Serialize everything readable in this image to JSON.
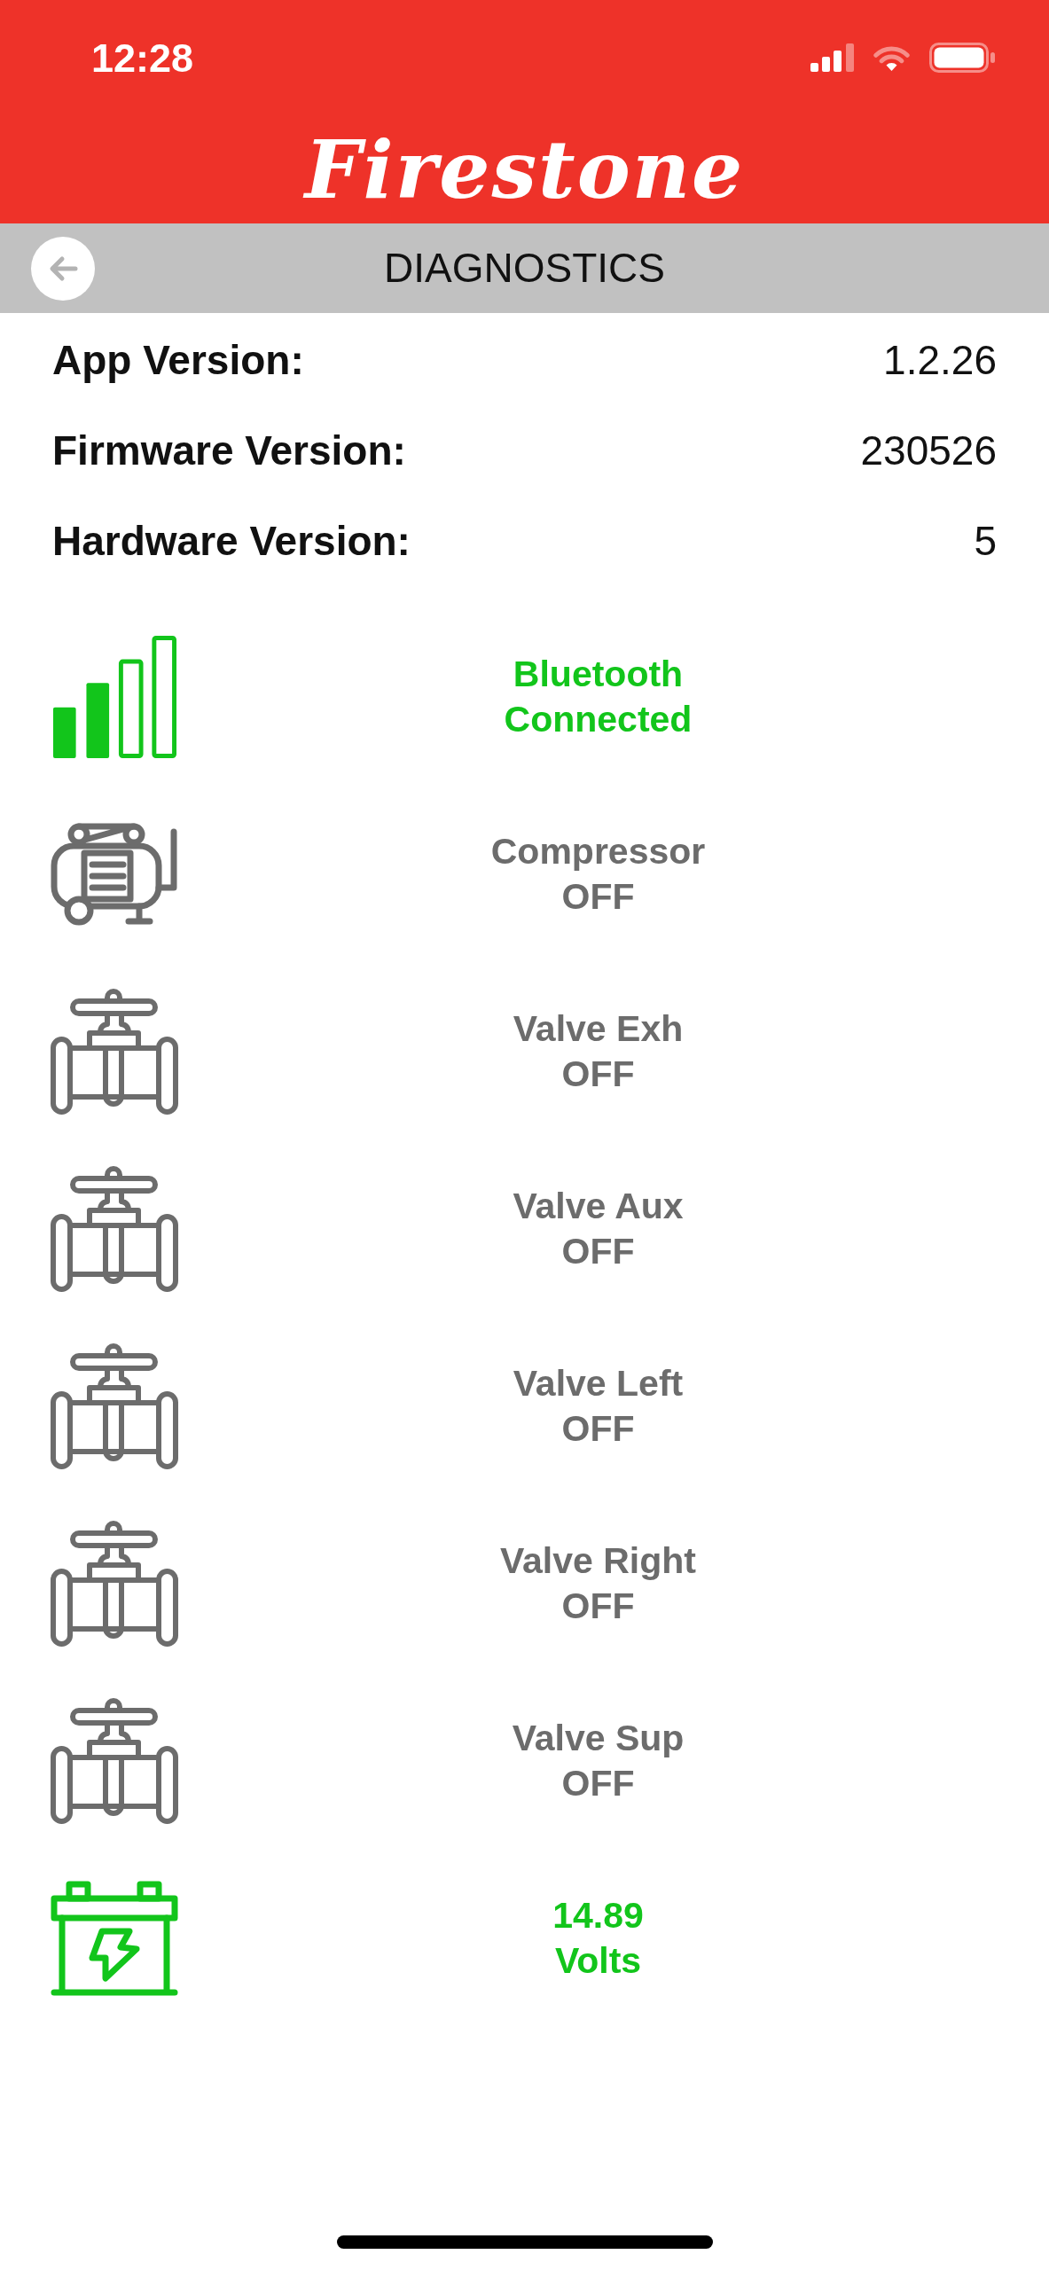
{
  "status_bar": {
    "time": "12:28"
  },
  "header": {
    "logo": "Firestone"
  },
  "nav_bar": {
    "title": "DIAGNOSTICS"
  },
  "info": [
    {
      "label": "App Version:",
      "value": "1.2.26"
    },
    {
      "label": "Firmware Version:",
      "value": "230526"
    },
    {
      "label": "Hardware Version:",
      "value": "5"
    }
  ],
  "statuses": [
    {
      "kind": "signal",
      "active": true,
      "lines": [
        "Bluetooth",
        "Connected"
      ]
    },
    {
      "kind": "compressor",
      "active": false,
      "lines": [
        "Compressor",
        "OFF"
      ]
    },
    {
      "kind": "valve",
      "active": false,
      "lines": [
        "Valve Exh",
        "OFF"
      ]
    },
    {
      "kind": "valve",
      "active": false,
      "lines": [
        "Valve Aux",
        "OFF"
      ]
    },
    {
      "kind": "valve",
      "active": false,
      "lines": [
        "Valve Left",
        "OFF"
      ]
    },
    {
      "kind": "valve",
      "active": false,
      "lines": [
        "Valve Right",
        "OFF"
      ]
    },
    {
      "kind": "valve",
      "active": false,
      "lines": [
        "Valve Sup",
        "OFF"
      ]
    },
    {
      "kind": "battery",
      "active": true,
      "lines": [
        "14.89",
        "Volts"
      ]
    }
  ]
}
